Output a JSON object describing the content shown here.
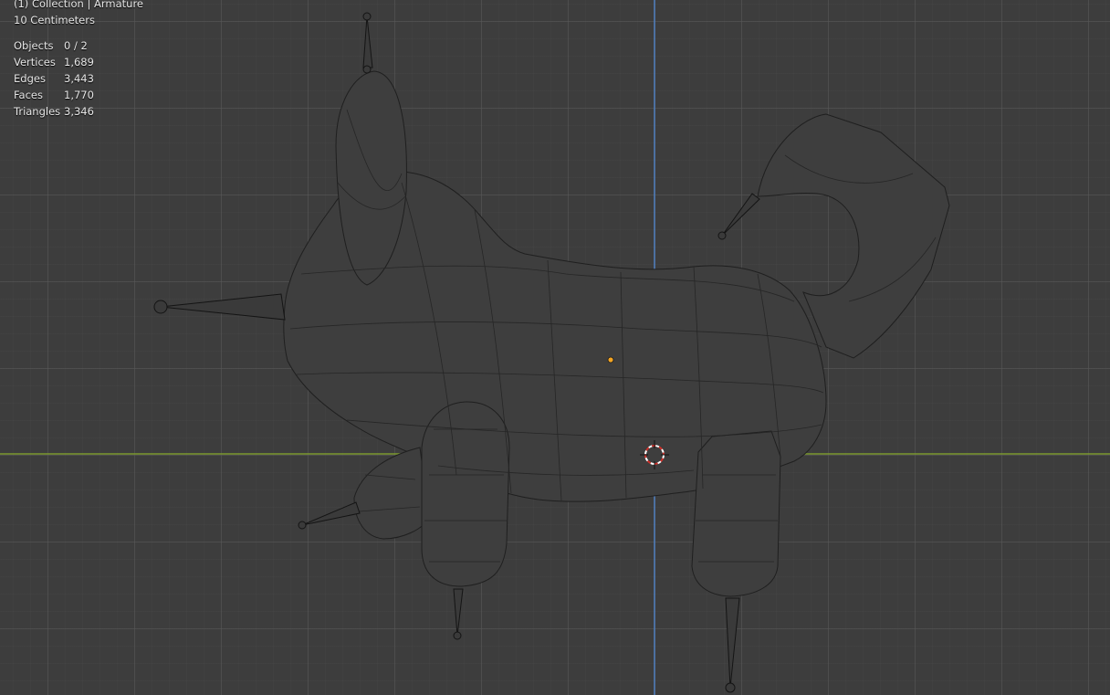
{
  "viewport": {
    "header_line": "(1) Collection | Armature",
    "scale_line": "10 Centimeters",
    "axis_colors": {
      "x_axis": "#7c9a2e",
      "z_axis": "#4f7fbf"
    },
    "mesh_color": "#222222",
    "mesh_fill": "#3e3e3e"
  },
  "stats": [
    {
      "label": "Objects",
      "value": "0 / 2"
    },
    {
      "label": "Vertices",
      "value": "1,689"
    },
    {
      "label": "Edges",
      "value": "3,443"
    },
    {
      "label": "Faces",
      "value": "1,770"
    },
    {
      "label": "Triangles",
      "value": "3,346"
    }
  ]
}
